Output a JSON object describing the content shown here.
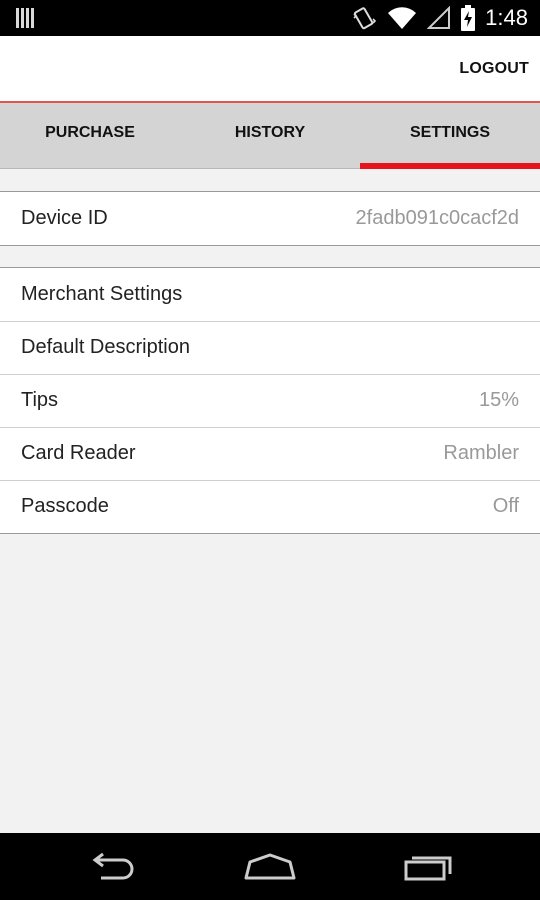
{
  "status_bar": {
    "time": "1:48",
    "icons": [
      "notification-icon",
      "vibrate-icon",
      "wifi-icon",
      "signal-icon",
      "battery-charging-icon"
    ]
  },
  "action_bar": {
    "logout_label": "LOGOUT",
    "accent_color": "#e8141b"
  },
  "tabs": [
    {
      "label": "PURCHASE",
      "active": false
    },
    {
      "label": "HISTORY",
      "active": false
    },
    {
      "label": "SETTINGS",
      "active": true
    }
  ],
  "device": {
    "label": "Device ID",
    "value": "2fadb091c0cacf2d"
  },
  "settings": [
    {
      "label": "Merchant Settings",
      "value": ""
    },
    {
      "label": "Default Description",
      "value": ""
    },
    {
      "label": "Tips",
      "value": "15%"
    },
    {
      "label": "Card Reader",
      "value": "Rambler"
    },
    {
      "label": "Passcode",
      "value": "Off"
    }
  ],
  "nav_bar": {
    "icons": [
      "back-icon",
      "home-icon",
      "recent-apps-icon"
    ]
  }
}
